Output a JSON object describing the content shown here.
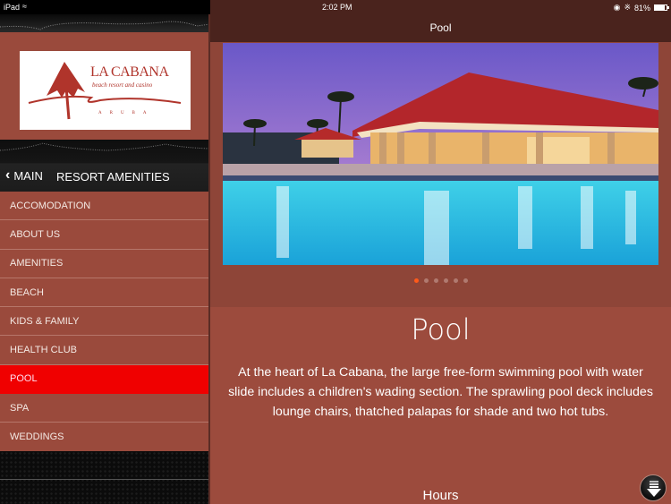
{
  "status_bar": {
    "device": "iPad",
    "time": "2:02 PM",
    "battery_percent_label": "81%",
    "battery_level": 0.81,
    "icons": [
      "wifi-icon",
      "orientation-lock-icon",
      "bluetooth-icon",
      "battery-icon"
    ]
  },
  "sidebar": {
    "logo": {
      "name": "LA CABANA",
      "tagline": "beach resort and casino",
      "location": "ARUBA"
    },
    "nav": {
      "back_label": "MAIN",
      "title": "RESORT AMENITIES"
    },
    "items": [
      {
        "label": "ACCOMODATION",
        "active": false
      },
      {
        "label": "ABOUT US",
        "active": false
      },
      {
        "label": "AMENITIES",
        "active": false
      },
      {
        "label": "BEACH",
        "active": false
      },
      {
        "label": "KIDS & FAMILY",
        "active": false
      },
      {
        "label": "HEALTH CLUB",
        "active": false
      },
      {
        "label": "POOL",
        "active": true
      },
      {
        "label": "SPA",
        "active": false
      },
      {
        "label": "WEDDINGS",
        "active": false
      }
    ]
  },
  "main": {
    "header_title": "Pool",
    "gallery": {
      "image_description": "Resort pool at dusk with red-roofed bar pavilion and palm trees",
      "page_count": 6,
      "current_page": 1
    },
    "content": {
      "title": "Pool",
      "body": "At the heart of La Cabana, the large free-form swimming pool with water slide includes a children's wading section. The sprawling pool deck includes lounge chairs, thatched palapas for shade and two hot tubs.",
      "section_heading": "Hours"
    }
  },
  "colors": {
    "sidebar_bg": "#9a4a3c",
    "active_item": "#f00000",
    "header_bg": "#4a231d",
    "active_dot": "#ff5a1a"
  }
}
